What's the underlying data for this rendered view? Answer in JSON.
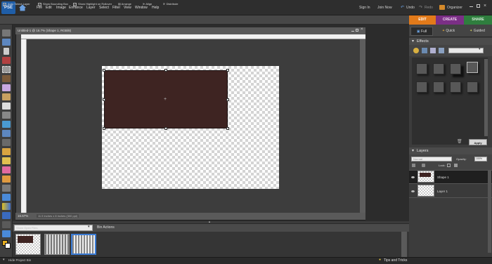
{
  "app": {
    "logo_text": "PSE"
  },
  "menu": [
    "File",
    "Edit",
    "Image",
    "Enhance",
    "Layer",
    "Select",
    "Filter",
    "View",
    "Window",
    "Help"
  ],
  "top_right": {
    "sign_in": "Sign In",
    "join_now": "Join Now",
    "undo": "Undo",
    "redo": "Redo",
    "organizer": "Organizer"
  },
  "options": {
    "auto_select": "Auto Select Layer",
    "show_bbox": "Show Bounding Box",
    "show_highlight": "Show Highlight on Rollover",
    "arrange": "Arrange",
    "align": "Align",
    "distribute": "Distribute"
  },
  "mode_tabs": {
    "edit": "EDIT",
    "create": "CREATE",
    "share": "SHARE"
  },
  "edit_modes": {
    "full": "Full",
    "quick": "Quick",
    "guided": "Guided"
  },
  "document": {
    "title": "Untitled-1 @ 16.7% (Shape 1, RGB/8)",
    "zoom": "16.67%",
    "dims": "11.5 inches x 8 inches (300 ppi)"
  },
  "project_bin": {
    "select_value": "Show Open Files",
    "actions": "Bin Actions"
  },
  "bottom": {
    "hide_bin": "Hide Project Bin",
    "tips": "Tips and Tricks"
  },
  "effects": {
    "header": "Effects",
    "apply": "Apply"
  },
  "layers": {
    "header": "Layers",
    "blend_mode": "Normal",
    "opacity_label": "Opacity:",
    "opacity_value": "100%",
    "lock_label": "Lock:",
    "items": [
      {
        "name": "Shape 1",
        "selected": true
      },
      {
        "name": "Layer 1",
        "selected": false
      }
    ]
  },
  "colors": {
    "shape_fill": "#3e2422",
    "edit_tab": "#e27a1a",
    "create_tab": "#7b2f86",
    "share_tab": "#2f7e3e"
  }
}
